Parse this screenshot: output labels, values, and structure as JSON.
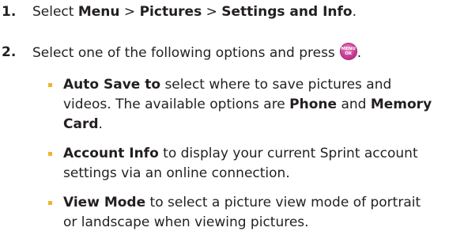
{
  "steps": [
    {
      "number": "1.",
      "prefix": "Select ",
      "menu": "Menu",
      "sep1": " > ",
      "pictures": "Pictures",
      "sep2": " > ",
      "settings": "Settings and Info",
      "suffix": "."
    },
    {
      "number": "2.",
      "text": "Select one of the following options and press",
      "icon_top": "MENU",
      "icon_bottom": "OK",
      "suffix": "."
    }
  ],
  "options": [
    {
      "term": "Auto Save to",
      "line1_rest": " select where to save pictures and",
      "line2_a": "videos. The available options are ",
      "phone": "Phone",
      "line2_and": " and ",
      "memory": "Memory",
      "card": "Card",
      "card_suffix": "."
    },
    {
      "term": "Account Info",
      "line1_rest": " to display your current Sprint account",
      "line2": "settings via an online connection."
    },
    {
      "term": "View Mode",
      "line1_rest": " to select a picture view mode of portrait",
      "line2": "or landscape when viewing pictures."
    }
  ],
  "colors": {
    "text": "#231f20",
    "bullet": "#f2b035",
    "icon": "#c53a95"
  },
  "icons": {
    "menu_ok_key": "menu-ok-key-icon"
  }
}
